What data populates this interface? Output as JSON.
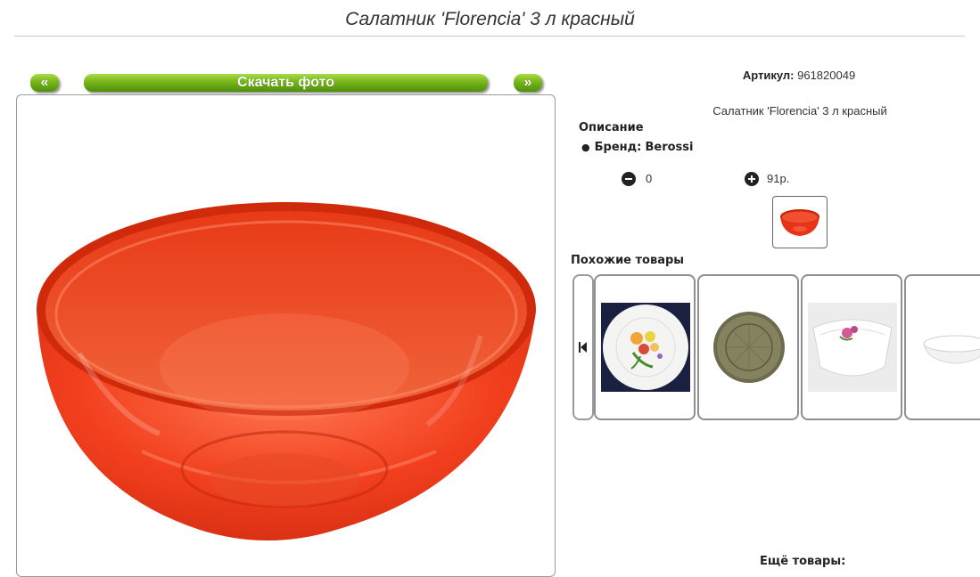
{
  "page": {
    "title": "Салатник 'Florencia' 3 л красный"
  },
  "gallery": {
    "prev_label": "«",
    "download_label": "Скачать фото",
    "next_label": "»"
  },
  "product": {
    "article_label": "Артикул:",
    "article_value": "961820049",
    "short_description": "Салатник 'Florencia' 3 л красный",
    "description_heading": "Описание",
    "brand_label": "Бренд:",
    "brand_value": "Berossi",
    "quantity": "0",
    "price": "91р.",
    "accent_color": "#e8321a"
  },
  "similar": {
    "heading": "Похожие товары",
    "items": [
      {
        "icon": "floral-plate-image"
      },
      {
        "icon": "smoky-glass-plate-image"
      },
      {
        "icon": "square-floral-bowl-image"
      },
      {
        "icon": "white-bowl-image"
      }
    ]
  },
  "more": {
    "heading": "Ещё товары:"
  }
}
